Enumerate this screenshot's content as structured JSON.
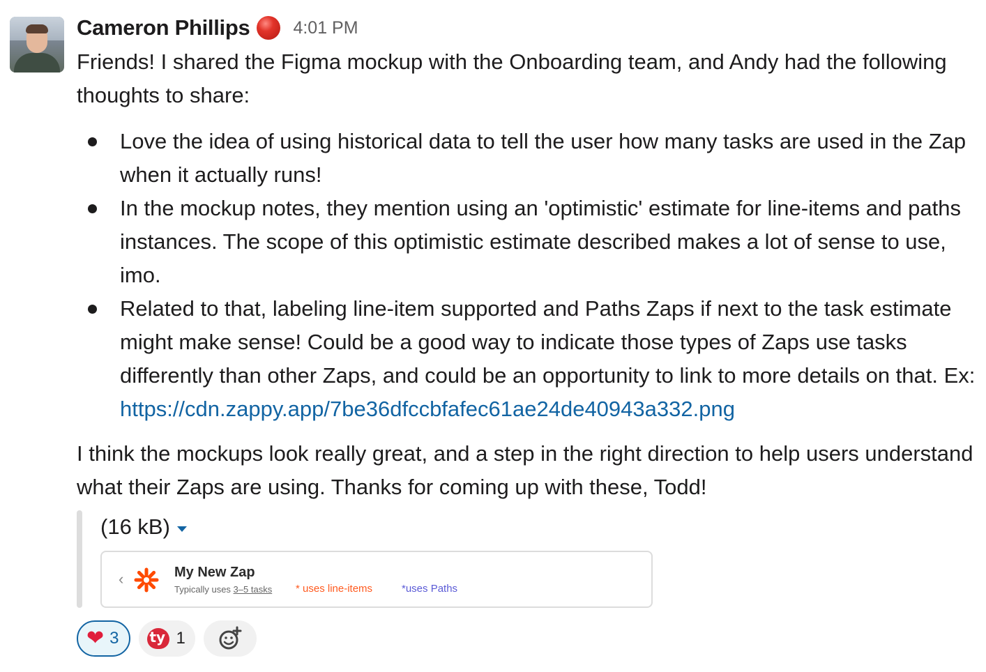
{
  "message": {
    "author": "Cameron Phillips",
    "time": "4:01 PM",
    "intro": "Friends! I shared the Figma mockup with the Onboarding team, and Andy had the following thoughts to share:",
    "bullets": [
      "Love the idea of using historical data to tell the user how many tasks are used in the Zap when it actually runs!",
      "In the mockup notes, they mention using an 'optimistic' estimate for line-items and paths instances. The scope of this optimistic estimate described makes a lot of sense to use, imo.",
      "Related to that, labeling line-item supported and Paths Zaps if next to the task estimate might make sense! Could be a good way to indicate those types of Zaps use tasks differently than other Zaps, and could be an opportunity to link to more details on that.  Ex: "
    ],
    "link": "https://cdn.zappy.app/7be36dfccbfafec61ae24de40943a332.png",
    "closing": "I think the mockups look really great, and a step in the right direction to help users understand what their Zaps are using. Thanks for coming up with these, Todd!"
  },
  "attachment": {
    "size": "(16 kB)",
    "preview": {
      "back": "‹",
      "title": "My New Zap",
      "subtitle_prefix": "Typically uses ",
      "subtitle_range": "3–5 tasks",
      "line_items": "* uses line-items",
      "paths": "*uses Paths"
    }
  },
  "reactions": [
    {
      "emoji": "heart",
      "glyph": "❤",
      "count": "3",
      "active": true
    },
    {
      "emoji": "ty-heart",
      "count": "1",
      "active": false
    }
  ],
  "add_reaction_icon": "emoji-add-icon",
  "colors": {
    "link": "#1264a3",
    "status": "#e2342a",
    "line_items": "#ff5a1f",
    "paths": "#5b5bd6"
  }
}
